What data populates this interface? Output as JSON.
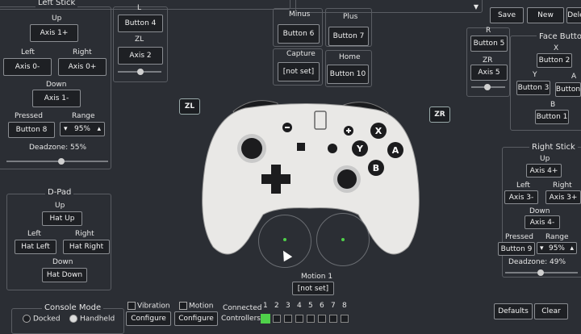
{
  "top_bar": {
    "save": "Save",
    "new": "New",
    "delete": "Delete"
  },
  "left_stick": {
    "title": "Left Stick",
    "up_label": "Up",
    "up_value": "Axis 1+",
    "left_label": "Left",
    "left_value": "Axis 0-",
    "right_label": "Right",
    "right_value": "Axis 0+",
    "down_label": "Down",
    "down_value": "Axis 1-",
    "pressed_label": "Pressed",
    "pressed_value": "Button 8",
    "range_label": "Range",
    "range_value": "95%",
    "deadzone": "Deadzone: 55%"
  },
  "l": {
    "label": "L",
    "value": "Button 4"
  },
  "zl": {
    "label": "ZL",
    "value": "Axis 2"
  },
  "minus": {
    "label": "Minus",
    "value": "Button 6"
  },
  "plus": {
    "label": "Plus",
    "value": "Button 7"
  },
  "capture": {
    "label": "Capture",
    "value": "[not set]"
  },
  "home": {
    "label": "Home",
    "value": "Button 10"
  },
  "r": {
    "label": "R",
    "value": "Button 5"
  },
  "zr": {
    "label": "ZR",
    "value": "Axis 5"
  },
  "face": {
    "title": "Face Buttons",
    "x_label": "X",
    "x_value": "Button 2",
    "y_label": "Y",
    "y_value": "Button 3",
    "a_label": "A",
    "a_value": "Button",
    "b_label": "B",
    "b_value": "Button 1"
  },
  "right_stick": {
    "title": "Right Stick",
    "up_label": "Up",
    "up_value": "Axis 4+",
    "left_label": "Left",
    "left_value": "Axis 3-",
    "right_label": "Right",
    "right_value": "Axis 3+",
    "down_label": "Down",
    "down_value": "Axis 4-",
    "pressed_label": "Pressed",
    "pressed_value": "Button 9",
    "range_label": "Range",
    "range_value": "95%",
    "deadzone": "Deadzone: 49%"
  },
  "dpad": {
    "title": "D-Pad",
    "up_label": "Up",
    "up_value": "Hat Up",
    "left_label": "Left",
    "left_value": "Hat Left",
    "right_label": "Right",
    "right_value": "Hat Right",
    "down_label": "Down",
    "down_value": "Hat Down"
  },
  "shoulder_zl": "ZL",
  "shoulder_zr": "ZR",
  "motion": {
    "label": "Motion 1",
    "value": "[not set]"
  },
  "console_mode": {
    "title": "Console Mode",
    "docked": "Docked",
    "handheld": "Handheld"
  },
  "vibration": {
    "label": "Vibration",
    "configure": "Configure"
  },
  "motion_cfg": {
    "label": "Motion",
    "configure": "Configure"
  },
  "connected": {
    "label1": "Connected",
    "label2": "Controllers",
    "slots": [
      "1",
      "2",
      "3",
      "4",
      "5",
      "6",
      "7",
      "8"
    ]
  },
  "defaults": "Defaults",
  "clear": "Clear",
  "face_glyphs": {
    "x": "X",
    "y": "Y",
    "a": "A",
    "b": "B"
  },
  "colors": {
    "background": "#2b2e34",
    "field": "#1e2024",
    "controller": "#e9e8e6",
    "connected_green": "#4fd14a"
  }
}
